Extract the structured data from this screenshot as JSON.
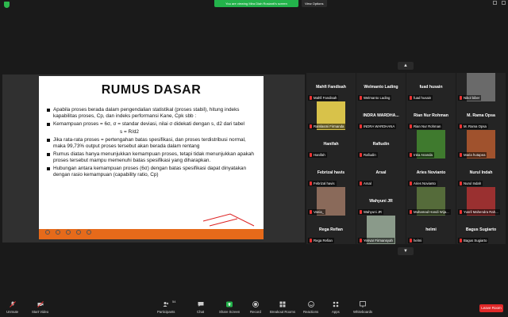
{
  "top": {
    "share_banner": "You are viewing Mira Diah Rosianti's screen",
    "view_options": "View Options"
  },
  "slide": {
    "title": "RUMUS DASAR",
    "bullets": [
      "Apabila proses berada dalam pengendalian statistikal (proses stabil), hitung indeks kapabilitas proses, Cp, dan indeks performansi Kane, Cpk sbb :",
      "Kemampuan proses = 6σ,  σ = standar deviasi, nilai σ didekati dengan s, d2 dari tabel",
      "Jika rata-rata proses = pertengahan batas spesifikasi, dan proses terdistribusi normal, maka 99,73% output proses tersebut akan berada dalam rentang",
      "Rumus diatas hanya menunjukkan  kemampuan proses, tetapi tidak menunjukkan apakah proses tersebut mampu memenuhi batas spesifikasi yang diharapkan.",
      "Hubungan antara kemampuan proses (6σ) dengan batas spesifikasi dapat dinyatakan dengan rasio kemampuan (capability ratio, Cp)"
    ],
    "formula": "s = R/d2"
  },
  "participants": [
    {
      "big": "Mahfi Fandisah",
      "label": "Mahfi Fandisah",
      "photo": null
    },
    {
      "big": "Welmanto Lading",
      "label": "Welmanto Lading",
      "photo": null
    },
    {
      "big": "fuad husain",
      "label": "fuad husain",
      "photo": null
    },
    {
      "big": "",
      "label": "Nikol biber",
      "photo": "#6a6a6a"
    },
    {
      "big": "",
      "label": "Ramlasmi Firmanda",
      "photo": "#d8c24a"
    },
    {
      "big": "INDRA WARDHA...",
      "label": "INDRA WARDHANA",
      "photo": null
    },
    {
      "big": "Rian Nur Rohman",
      "label": "Rian Nur Rohman",
      "photo": null
    },
    {
      "big": "M. Rama Opsa",
      "label": "M. Rama Opsa",
      "photo": null
    },
    {
      "big": "Hanifah",
      "label": "Hanifah",
      "photo": null
    },
    {
      "big": "Rafiudin",
      "label": "Rafiudin",
      "photo": null
    },
    {
      "big": "",
      "label": "Inka Ananda",
      "photo": "#3f7a2e"
    },
    {
      "big": "",
      "label": "Maria hutapea",
      "photo": "#a0522d"
    },
    {
      "big": "Febrizal havis",
      "label": "Febrizal havis",
      "photo": null
    },
    {
      "big": "Arsal",
      "label": "Arsal",
      "photo": null
    },
    {
      "big": "Aries Novianto",
      "label": "Aries Novianto",
      "photo": null
    },
    {
      "big": "Nurul Indah",
      "label": "Nurul Indah",
      "photo": null
    },
    {
      "big": "",
      "label": "Vania_",
      "photo": "#8a6a5a"
    },
    {
      "big": "Wahyuni JR",
      "label": "Wahyuni JR",
      "photo": null
    },
    {
      "big": "",
      "label": "Muhamad Handi Wija...",
      "photo": "#556b3a"
    },
    {
      "big": "",
      "label": "Yusril Mahendra Rah...",
      "photo": "#9a3030"
    },
    {
      "big": "Rega Refian",
      "label": "Rega Refian",
      "photo": null
    },
    {
      "big": "",
      "label": "Yenvar Firmansyah",
      "photo": "#8a9a8a"
    },
    {
      "big": "helmi",
      "label": "helmi",
      "photo": null
    },
    {
      "big": "Bagus Sugiarto",
      "label": "Bagus Sugiarto",
      "photo": null
    }
  ],
  "toolbar": {
    "unmute": "Unmute",
    "start_video": "Start Video",
    "participants": "Participants",
    "participants_count": "54",
    "chat": "Chat",
    "share_screen": "Share Screen",
    "record": "Record",
    "breakout": "Breakout Rooms",
    "reactions": "Reactions",
    "apps": "Apps",
    "whiteboards": "Whiteboards",
    "leave": "Leave Room"
  },
  "colors": {
    "accent_green": "#23b34b",
    "slide_footer": "#e66a1a",
    "leave_red": "#e02828"
  }
}
